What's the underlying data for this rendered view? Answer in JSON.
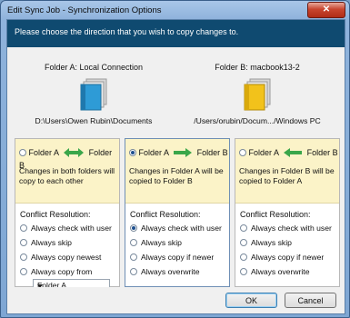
{
  "window": {
    "title": "Edit Sync Job - Synchronization Options",
    "close_label": "✕"
  },
  "banner": {
    "text": "Please choose the direction that you wish to copy changes to."
  },
  "folder_a": {
    "label": "Folder A: Local Connection",
    "path": "D:\\Users\\Owen Rubin\\Documents",
    "icon_color": "#2e9bd6"
  },
  "folder_b": {
    "label": "Folder B: macbook13-2",
    "path": "/Users/orubin/Docum.../Windows PC",
    "icon_color": "#f2c21b"
  },
  "panels": [
    {
      "left": "Folder A",
      "right": "Folder B",
      "direction": "both",
      "selected": false,
      "description": "Changes in both folders will copy to each other",
      "conflict_label": "Conflict Resolution:",
      "options": [
        "Always check with user",
        "Always skip",
        "Always copy newest",
        "Always copy from"
      ],
      "checked_option": null,
      "dropdown": "Folder A"
    },
    {
      "left": "Folder A",
      "right": "Folder B",
      "direction": "a_to_b",
      "selected": true,
      "description": "Changes in Folder A will be copied to Folder B",
      "conflict_label": "Conflict Resolution:",
      "options": [
        "Always check with user",
        "Always skip",
        "Always copy if newer",
        "Always overwrite"
      ],
      "checked_option": 0
    },
    {
      "left": "Folder A",
      "right": "Folder B",
      "direction": "b_to_a",
      "selected": false,
      "description": "Changes in Folder B will be copied to Folder A",
      "conflict_label": "Conflict Resolution:",
      "options": [
        "Always check with user",
        "Always skip",
        "Always copy if newer",
        "Always overwrite"
      ],
      "checked_option": null
    }
  ],
  "buttons": {
    "ok": "OK",
    "cancel": "Cancel"
  },
  "colors": {
    "banner_bg": "#0f4a70",
    "panel_head_bg": "#fbf3c8",
    "arrow_green": "#3aa64a"
  }
}
